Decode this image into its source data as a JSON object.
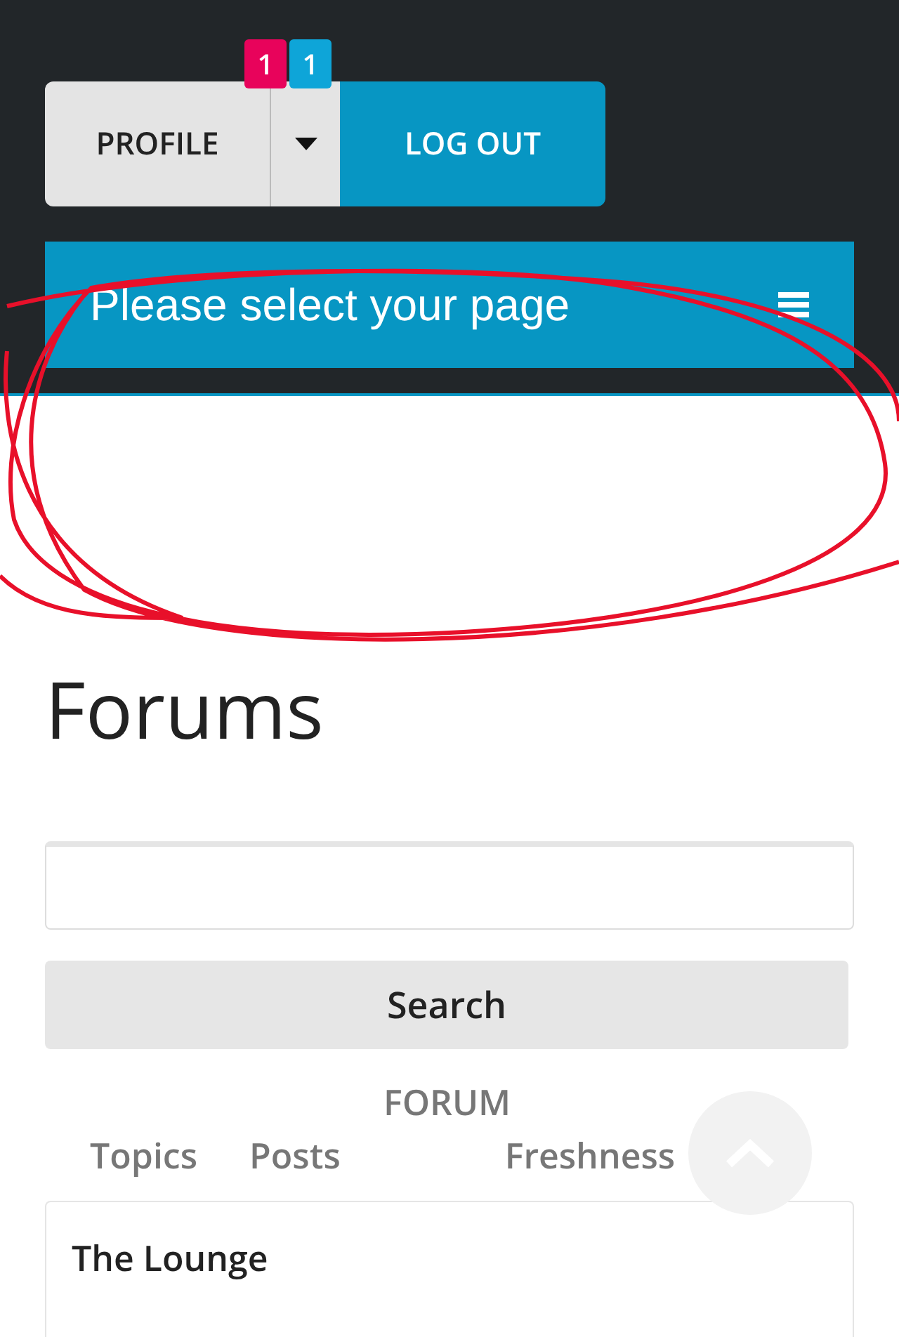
{
  "header": {
    "profile_button": "PROFILE",
    "badges": [
      {
        "text": "1",
        "color": "#e8035b"
      },
      {
        "text": "1",
        "color": "#0ea5d8"
      }
    ],
    "logout_button": "LOG OUT",
    "page_select": "Please select your page"
  },
  "title": "Forums",
  "search": {
    "button": "Search"
  },
  "table_header": {
    "title": "FORUM",
    "columns": [
      "Topics",
      "Posts",
      "Freshness"
    ]
  },
  "forums": [
    {
      "name": "The Lounge"
    }
  ]
}
